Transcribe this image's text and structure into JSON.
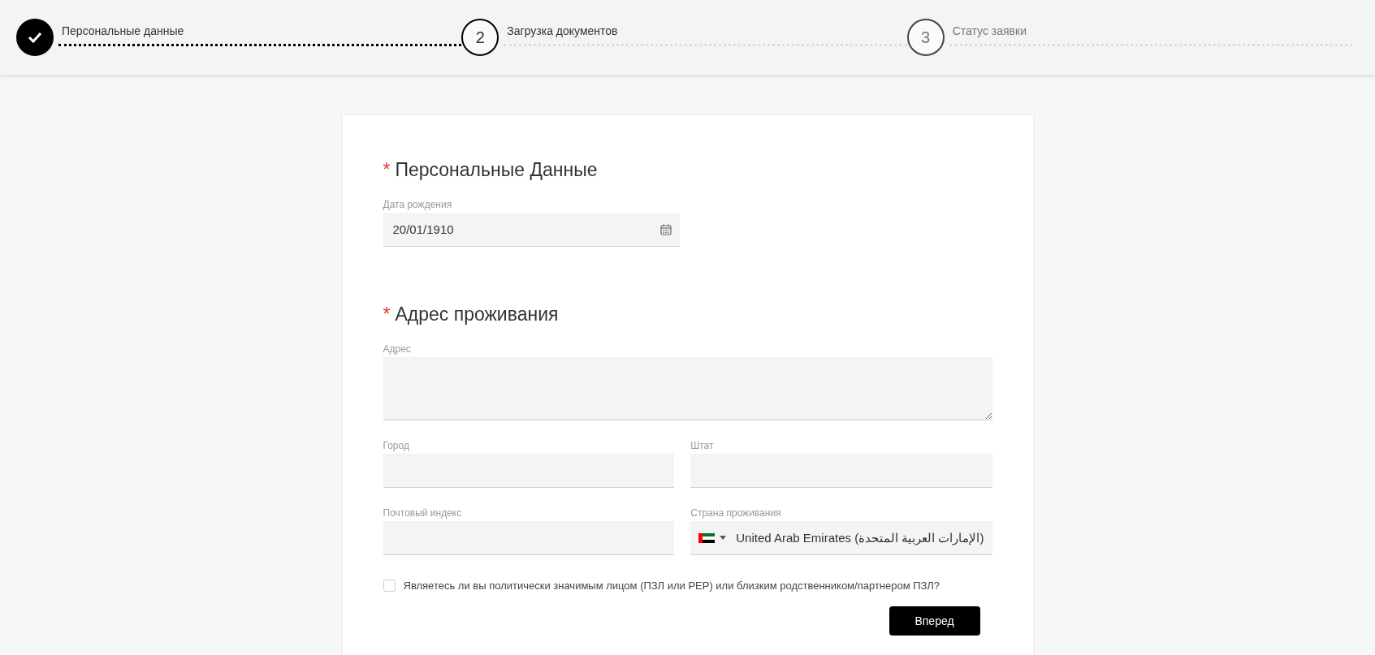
{
  "stepper": [
    {
      "label": "Персональные данные",
      "done": true,
      "selected": false
    },
    {
      "number": "2",
      "label": "Загрузка документов",
      "done": false,
      "selected": true
    },
    {
      "number": "3",
      "label": "Статус заявки",
      "done": false,
      "selected": false
    }
  ],
  "sections": [
    {
      "required_mark": "*",
      "title": "Персональные Данные",
      "fields": [
        {
          "kind": "date",
          "label": "Дата рождения",
          "value": "20/01/1910"
        }
      ]
    },
    {
      "required_mark": "*",
      "title": "Адрес проживания",
      "fields": [
        {
          "kind": "textarea",
          "label": "Адрес"
        },
        {
          "kind": "text",
          "label": "Город"
        },
        {
          "kind": "text",
          "label": "Штат"
        },
        {
          "kind": "text",
          "label": "Почтовый индекс"
        },
        {
          "kind": "country",
          "label": "Страна проживания",
          "value": "United Arab Emirates (الإمارات العربية المتحدة)"
        }
      ]
    }
  ],
  "pep_checkbox": {
    "label": "Являетесь ли вы политически значимым лицом (ПЗЛ или PEP) или близким родственником/партнером ПЗЛ?",
    "checked": false
  },
  "next_button": "Вперед"
}
